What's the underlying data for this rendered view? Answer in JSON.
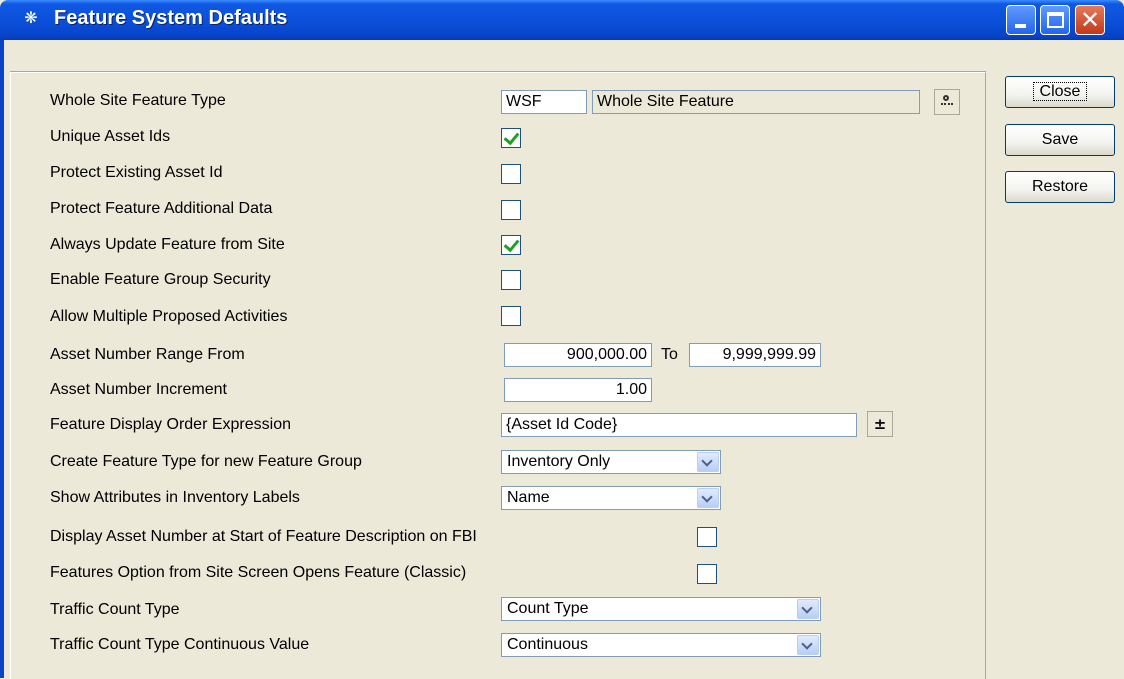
{
  "window": {
    "title": "Feature System Defaults",
    "icon": "app-gear-icon",
    "colors": {
      "titlebar": "#0A4FD9",
      "body": "#ECE9D8"
    }
  },
  "buttons": {
    "close": "Close",
    "save": "Save",
    "restore": "Restore"
  },
  "form": {
    "whole_site_feature_type": {
      "label": "Whole Site Feature Type",
      "code": "WSF",
      "description": "Whole Site Feature"
    },
    "unique_asset_ids": {
      "label": "Unique Asset Ids",
      "checked": true
    },
    "protect_existing_asset_id": {
      "label": "Protect Existing Asset Id",
      "checked": false
    },
    "protect_feature_additional_data": {
      "label": "Protect Feature Additional Data",
      "checked": false
    },
    "always_update_feature_from_site": {
      "label": "Always Update Feature from Site",
      "checked": true
    },
    "enable_feature_group_security": {
      "label": "Enable Feature Group Security",
      "checked": false
    },
    "allow_multiple_proposed_activities": {
      "label": "Allow Multiple Proposed Activities",
      "checked": false
    },
    "asset_number_range": {
      "label": "Asset Number Range From",
      "from": "900,000.00",
      "to_label": "To",
      "to": "9,999,999.99"
    },
    "asset_number_increment": {
      "label": "Asset Number Increment",
      "value": "1.00"
    },
    "feature_display_order_expression": {
      "label": "Feature Display Order Expression",
      "value": "{Asset Id Code}"
    },
    "create_feature_type": {
      "label": "Create Feature Type for new Feature Group",
      "value": "Inventory Only"
    },
    "show_attributes": {
      "label": "Show Attributes in Inventory Labels",
      "value": "Name"
    },
    "display_asset_number": {
      "label": "Display Asset Number at Start of Feature Description on FBI",
      "checked": false
    },
    "features_option": {
      "label": "Features Option from Site Screen Opens Feature (Classic)",
      "checked": false
    },
    "traffic_count_type": {
      "label": "Traffic Count Type",
      "value": "Count Type"
    },
    "traffic_count_continuous": {
      "label": "Traffic Count Type Continuous Value",
      "value": "Continuous"
    }
  }
}
